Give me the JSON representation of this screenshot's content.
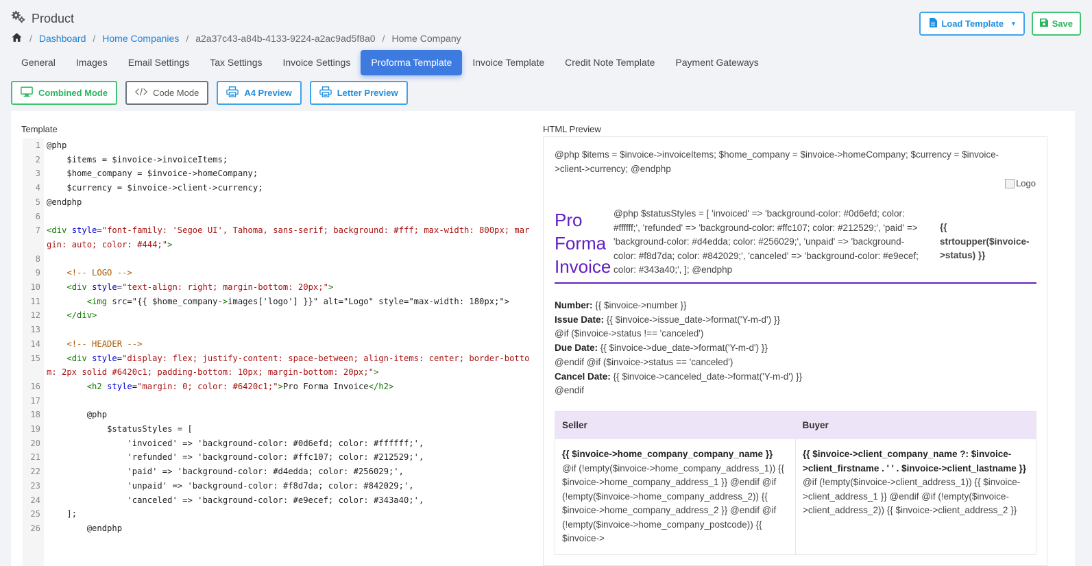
{
  "header": {
    "title": "Product",
    "breadcrumb": [
      "Dashboard",
      "Home Companies",
      "a2a37c43-a84b-4133-9224-a2ac9ad5f8a0",
      "Home Company"
    ]
  },
  "actions": {
    "load_template": "Load Template",
    "save": "Save"
  },
  "tabs": [
    "General",
    "Images",
    "Email Settings",
    "Tax Settings",
    "Invoice Settings",
    "Proforma Template",
    "Invoice Template",
    "Credit Note Template",
    "Payment Gateways"
  ],
  "active_tab": "Proforma Template",
  "modes": [
    "Combined Mode",
    "Code Mode",
    "A4 Preview",
    "Letter Preview"
  ],
  "template_label": "Template",
  "preview_label": "HTML Preview",
  "code_lines": [
    "@php",
    "    $items = $invoice->invoiceItems;",
    "    $home_company = $invoice->homeCompany;",
    "    $currency = $invoice->client->currency;",
    "@endphp",
    "",
    "<div style=\"font-family: 'Segoe UI', Tahoma, sans-serif; background: #fff; max-width: 800px; margin: auto; color: #444;\">",
    "",
    "    <!-- LOGO -->",
    "    <div style=\"text-align: right; margin-bottom: 20px;\">",
    "        <img src=\"{{ $home_company->images['logo'] }}\" alt=\"Logo\" style=\"max-width: 180px;\">",
    "    </div>",
    "",
    "    <!-- HEADER -->",
    "    <div style=\"display: flex; justify-content: space-between; align-items: center; border-bottom: 2px solid #6420c1; padding-bottom: 10px; margin-bottom: 20px;\">",
    "        <h2 style=\"margin: 0; color: #6420c1;\">Pro Forma Invoice</h2>",
    "",
    "        @php",
    "            $statusStyles = [",
    "                'invoiced' => 'background-color: #0d6efd; color: #ffffff;',",
    "                'refunded' => 'background-color: #ffc107; color: #212529;',",
    "                'paid' => 'background-color: #d4edda; color: #256029;',",
    "                'unpaid' => 'background-color: #f8d7da; color: #842029;',",
    "                'canceled' => 'background-color: #e9ecef; color: #343a40;',",
    "    ];",
    "        @endphp"
  ],
  "preview": {
    "php_block": "@php $items = $invoice->invoiceItems; $home_company = $invoice->homeCompany; $currency = $invoice->client->currency; @endphp",
    "logo_alt": "Logo",
    "heading": "Pro Forma Invoice",
    "status_styles": "@php $statusStyles = [ 'invoiced' => 'background-color: #0d6efd; color: #ffffff;', 'refunded' => 'background-color: #ffc107; color: #212529;', 'paid' => 'background-color: #d4edda; color: #256029;', 'unpaid' => 'background-color: #f8d7da; color: #842029;', 'canceled' => 'background-color: #e9ecef; color: #343a40;', ]; @endphp",
    "status_upper": "{{ strtoupper($invoice->status) }}",
    "number_label": "Number:",
    "number_value": "{{ $invoice->number }}",
    "issue_label": "Issue Date:",
    "issue_value": "{{ $invoice->issue_date->format('Y-m-d') }}",
    "if_not_canceled": "@if ($invoice->status !== 'canceled')",
    "due_label": "Due Date:",
    "due_value": "{{ $invoice->due_date->format('Y-m-d') }}",
    "endif_if_canceled": "@endif @if ($invoice->status == 'canceled')",
    "cancel_label": "Cancel Date:",
    "cancel_value": "{{ $invoice->canceled_date->format('Y-m-d') }}",
    "endif": "@endif",
    "seller_header": "Seller",
    "buyer_header": "Buyer",
    "seller_name": "{{ $invoice->home_company_company_name }}",
    "seller_text": "@if (!empty($invoice->home_company_address_1)) {{ $invoice->home_company_address_1 }} @endif @if (!empty($invoice->home_company_address_2)) {{ $invoice->home_company_address_2 }} @endif @if (!empty($invoice->home_company_postcode)) {{ $invoice->",
    "buyer_name": "{{ $invoice->client_company_name ?: $invoice->client_firstname . ' ' . $invoice->client_lastname }}",
    "buyer_text": "@if (!empty($invoice->client_address_1)) {{ $invoice->client_address_1 }} @endif @if (!empty($invoice->client_address_2)) {{ $invoice->client_address_2 }}"
  },
  "colors": {
    "primary": "#3d7be0",
    "success": "#29b65f",
    "info": "#1f8fe0",
    "invoice_accent": "#6420c1",
    "table_header": "#ede5f7"
  }
}
